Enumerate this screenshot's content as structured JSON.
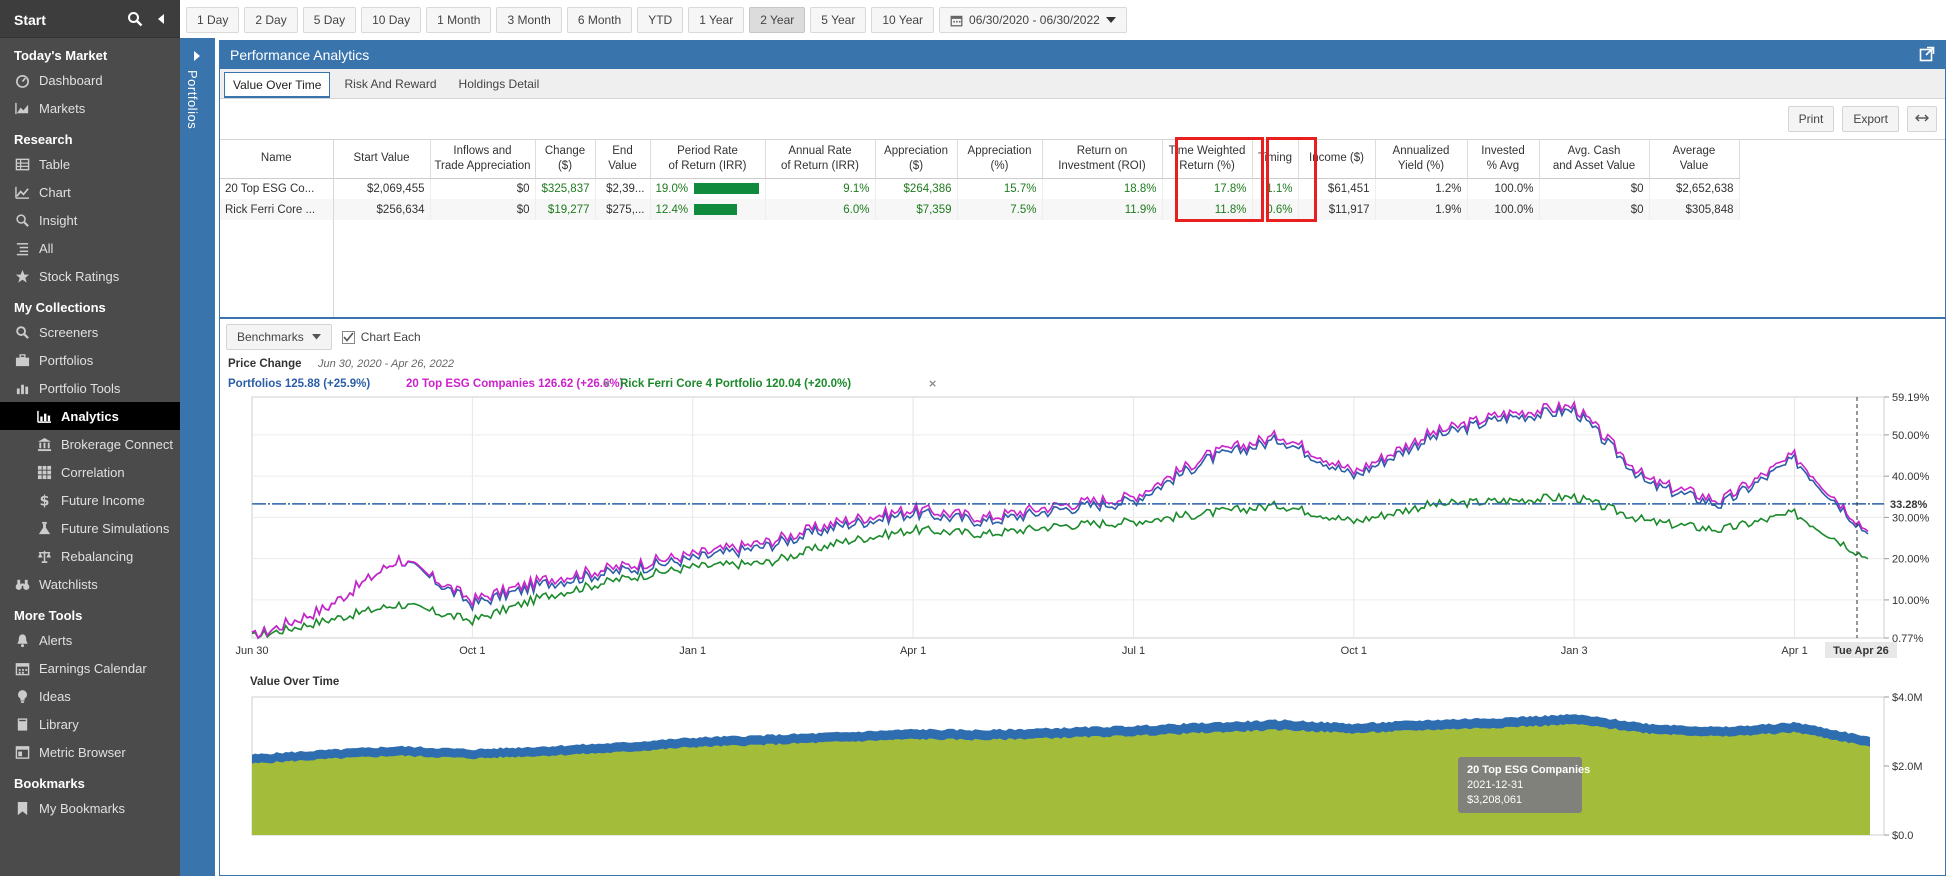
{
  "sidebar": {
    "start": "Start",
    "sections": [
      {
        "title": "Today's Market",
        "items": [
          {
            "label": "Dashboard",
            "icon": "gauge-icon"
          },
          {
            "label": "Markets",
            "icon": "chart-area-icon"
          }
        ]
      },
      {
        "title": "Research",
        "items": [
          {
            "label": "Table",
            "icon": "table-icon"
          },
          {
            "label": "Chart",
            "icon": "line-chart-icon"
          },
          {
            "label": "Insight",
            "icon": "magnifier-icon"
          },
          {
            "label": "All",
            "icon": "list-icon"
          },
          {
            "label": "Stock Ratings",
            "icon": "star-icon"
          }
        ]
      },
      {
        "title": "My Collections",
        "items": [
          {
            "label": "Screeners",
            "icon": "search-icon"
          },
          {
            "label": "Portfolios",
            "icon": "briefcase-icon"
          },
          {
            "label": "Portfolio Tools",
            "icon": "bar-chart-icon"
          },
          {
            "label": "Analytics",
            "icon": "analytics-icon",
            "sub": true,
            "active": true
          },
          {
            "label": "Brokerage Connect",
            "icon": "bank-icon",
            "sub": true
          },
          {
            "label": "Correlation",
            "icon": "grid-icon",
            "sub": true
          },
          {
            "label": "Future Income",
            "icon": "dollar-icon",
            "sub": true
          },
          {
            "label": "Future Simulations",
            "icon": "flask-icon",
            "sub": true
          },
          {
            "label": "Rebalancing",
            "icon": "scale-icon",
            "sub": true
          },
          {
            "label": "Watchlists",
            "icon": "binoculars-icon"
          }
        ]
      },
      {
        "title": "More Tools",
        "items": [
          {
            "label": "Alerts",
            "icon": "bell-icon"
          },
          {
            "label": "Earnings Calendar",
            "icon": "calendar-icon"
          },
          {
            "label": "Ideas",
            "icon": "lightbulb-icon"
          },
          {
            "label": "Library",
            "icon": "book-icon"
          },
          {
            "label": "Metric Browser",
            "icon": "browser-icon"
          }
        ]
      },
      {
        "title": "Bookmarks",
        "items": [
          {
            "label": "My Bookmarks",
            "icon": "bookmark-icon"
          }
        ]
      }
    ]
  },
  "side_tab": {
    "label": "Portfolios"
  },
  "toolbar": {
    "ranges": [
      "1 Day",
      "2 Day",
      "5 Day",
      "10 Day",
      "1 Month",
      "3 Month",
      "6 Month",
      "YTD",
      "1 Year",
      "2 Year",
      "5 Year",
      "10 Year"
    ],
    "active_range": "2 Year",
    "date_range": "06/30/2020 - 06/30/2022"
  },
  "panel": {
    "title": "Performance Analytics",
    "tabs": [
      "Value Over Time",
      "Risk And Reward",
      "Holdings Detail"
    ],
    "active_tab": "Value Over Time",
    "print_label": "Print",
    "export_label": "Export"
  },
  "table": {
    "columns": [
      "Name",
      "Start Value",
      "Inflows and Trade Appreciation",
      "Change ($)",
      "End Value",
      "Period Rate of Return (IRR)",
      "Annual Rate of Return (IRR)",
      "Appreciation ($)",
      "Appreciation (%)",
      "Return on Investment (ROI)",
      "Time Weighted Return (%)",
      "Timing",
      "Income ($)",
      "Annualized Yield (%)",
      "Invested % Avg",
      "Avg. Cash and Asset Value",
      "Average Value"
    ],
    "header_lines": [
      [
        "Name"
      ],
      [
        "Start Value"
      ],
      [
        "Inflows and",
        "Trade Appreciation"
      ],
      [
        "Change",
        "($)"
      ],
      [
        "End",
        "Value"
      ],
      [
        "Period Rate",
        "of Return (IRR)"
      ],
      [
        "Annual Rate",
        "of Return (IRR)"
      ],
      [
        "Appreciation",
        "($)"
      ],
      [
        "Appreciation",
        "(%)"
      ],
      [
        "Return on",
        "Investment (ROI)"
      ],
      [
        "Time Weighted",
        "Return (%)"
      ],
      [
        "Timing"
      ],
      [
        "Income ($)"
      ],
      [
        "Annualized",
        "Yield (%)"
      ],
      [
        "Invested",
        "% Avg"
      ],
      [
        "Avg. Cash",
        "and Asset Value"
      ],
      [
        "Average",
        "Value"
      ]
    ],
    "rows": [
      {
        "name": "20 Top ESG Co...",
        "start_value": "$2,069,455",
        "inflows": "$0",
        "change": "$325,837",
        "end_value": "$2,39...",
        "period_irr": "19.0%",
        "period_irr_value": 19.0,
        "annual_irr": "9.1%",
        "appreciation_usd": "$264,386",
        "appreciation_pct": "15.7%",
        "roi": "18.8%",
        "twr": "17.8%",
        "timing": "1.1%",
        "income": "$61,451",
        "yield": "1.2%",
        "invested": "100.0%",
        "avg_cash": "$0",
        "avg_value": "$2,652,638"
      },
      {
        "name": "Rick Ferri Core ...",
        "start_value": "$256,634",
        "inflows": "$0",
        "change": "$19,277",
        "end_value": "$275,...",
        "period_irr": "12.4%",
        "period_irr_value": 12.4,
        "annual_irr": "6.0%",
        "appreciation_usd": "$7,359",
        "appreciation_pct": "7.5%",
        "roi": "11.9%",
        "twr": "11.8%",
        "timing": "0.6%",
        "income": "$11,917",
        "yield": "1.9%",
        "invested": "100.0%",
        "avg_cash": "$0",
        "avg_value": "$305,848"
      }
    ]
  },
  "benchmarks": {
    "button_label": "Benchmarks",
    "chart_each_label": "Chart Each"
  },
  "price_chart": {
    "title": "Price Change",
    "date_span": "Jun 30, 2020 - Apr 26, 2022",
    "legend": [
      {
        "label": "Portfolios 125.88 (+25.9%)",
        "color": "#2b5ea7",
        "removable": false
      },
      {
        "label": "20 Top ESG Companies 126.62 (+26.6%)",
        "color": "#cc22cc",
        "removable": true
      },
      {
        "label": "Rick Ferri Core 4 Portfolio 120.04 (+20.0%)",
        "color": "#1b8a2b",
        "removable": true
      }
    ],
    "x_ticks": [
      "Jun 30",
      "Oct 1",
      "Jan 1",
      "Apr 1",
      "Jul 1",
      "Oct 1",
      "Jan 3",
      "Apr 1"
    ],
    "y_ticks": [
      "59.19%",
      "50.00%",
      "40.00%",
      "30.00%",
      "20.00%",
      "10.00%",
      "0.77%"
    ],
    "y_min": 0.77,
    "y_max": 59.19,
    "crosshair_value": "33.28%",
    "crosshair_date": "Tue Apr 26"
  },
  "chart_data": [
    {
      "type": "line",
      "title": "Price Change",
      "ylim": [
        0.77,
        59.19
      ],
      "x_months": [
        "2020-06-30",
        "2020-07-31",
        "2020-08-31",
        "2020-09-30",
        "2020-10-31",
        "2020-11-30",
        "2020-12-31",
        "2021-01-31",
        "2021-02-28",
        "2021-03-31",
        "2021-04-30",
        "2021-05-31",
        "2021-06-30",
        "2021-07-31",
        "2021-08-31",
        "2021-09-30",
        "2021-10-31",
        "2021-11-30",
        "2021-12-31",
        "2022-01-31",
        "2022-02-28",
        "2022-03-31",
        "2022-04-26"
      ],
      "series": [
        {
          "name": "Portfolios",
          "values": [
            1,
            8,
            20,
            9,
            14,
            17,
            20,
            23,
            28,
            31,
            29,
            32,
            34,
            44,
            49,
            40,
            49,
            54,
            56,
            38,
            33,
            44,
            26
          ],
          "color": "#2b5ea7"
        },
        {
          "name": "20 Top ESG Companies",
          "values": [
            1,
            8,
            20,
            10,
            15,
            18,
            21,
            24,
            29,
            32,
            30,
            33,
            35,
            45,
            50,
            41,
            50,
            55,
            57,
            39,
            34,
            45,
            26.6
          ],
          "color": "#cc22cc"
        },
        {
          "name": "Rick Ferri Core 4 Portfolio",
          "values": [
            1,
            5,
            9,
            5,
            11,
            15,
            18,
            19,
            24,
            27,
            26,
            28,
            29,
            31,
            33,
            29,
            33,
            34,
            35,
            29,
            27,
            31,
            20
          ],
          "color": "#1b8a2b"
        }
      ]
    },
    {
      "type": "area",
      "title": "Value Over Time",
      "y_ticks": [
        "$4.0M",
        "$2.0M",
        "$0.0"
      ],
      "ylim": [
        0,
        4.0
      ],
      "series": [
        {
          "name": "20 Top ESG Companies",
          "values": [
            2.07,
            2.2,
            2.3,
            2.22,
            2.3,
            2.4,
            2.55,
            2.62,
            2.7,
            2.78,
            2.76,
            2.82,
            2.88,
            2.97,
            3.05,
            2.95,
            3.05,
            3.12,
            3.21,
            2.95,
            2.85,
            2.98,
            2.56
          ],
          "color": "#a3bd3a"
        },
        {
          "name": "Portfolios",
          "values": [
            2.33,
            2.46,
            2.57,
            2.48,
            2.57,
            2.67,
            2.82,
            2.89,
            2.97,
            3.06,
            3.04,
            3.1,
            3.16,
            3.25,
            3.33,
            3.22,
            3.33,
            3.4,
            3.49,
            3.22,
            3.12,
            3.26,
            2.84
          ],
          "color": "#2d6db0"
        }
      ],
      "tooltip": {
        "name": "20 Top ESG Companies",
        "date": "2021-12-31",
        "value": "$3,208,061"
      }
    }
  ],
  "value_chart": {
    "title": "Value Over Time",
    "tooltip_name": "20 Top ESG Companies",
    "tooltip_date": "2021-12-31",
    "tooltip_value": "$3,208,061"
  }
}
